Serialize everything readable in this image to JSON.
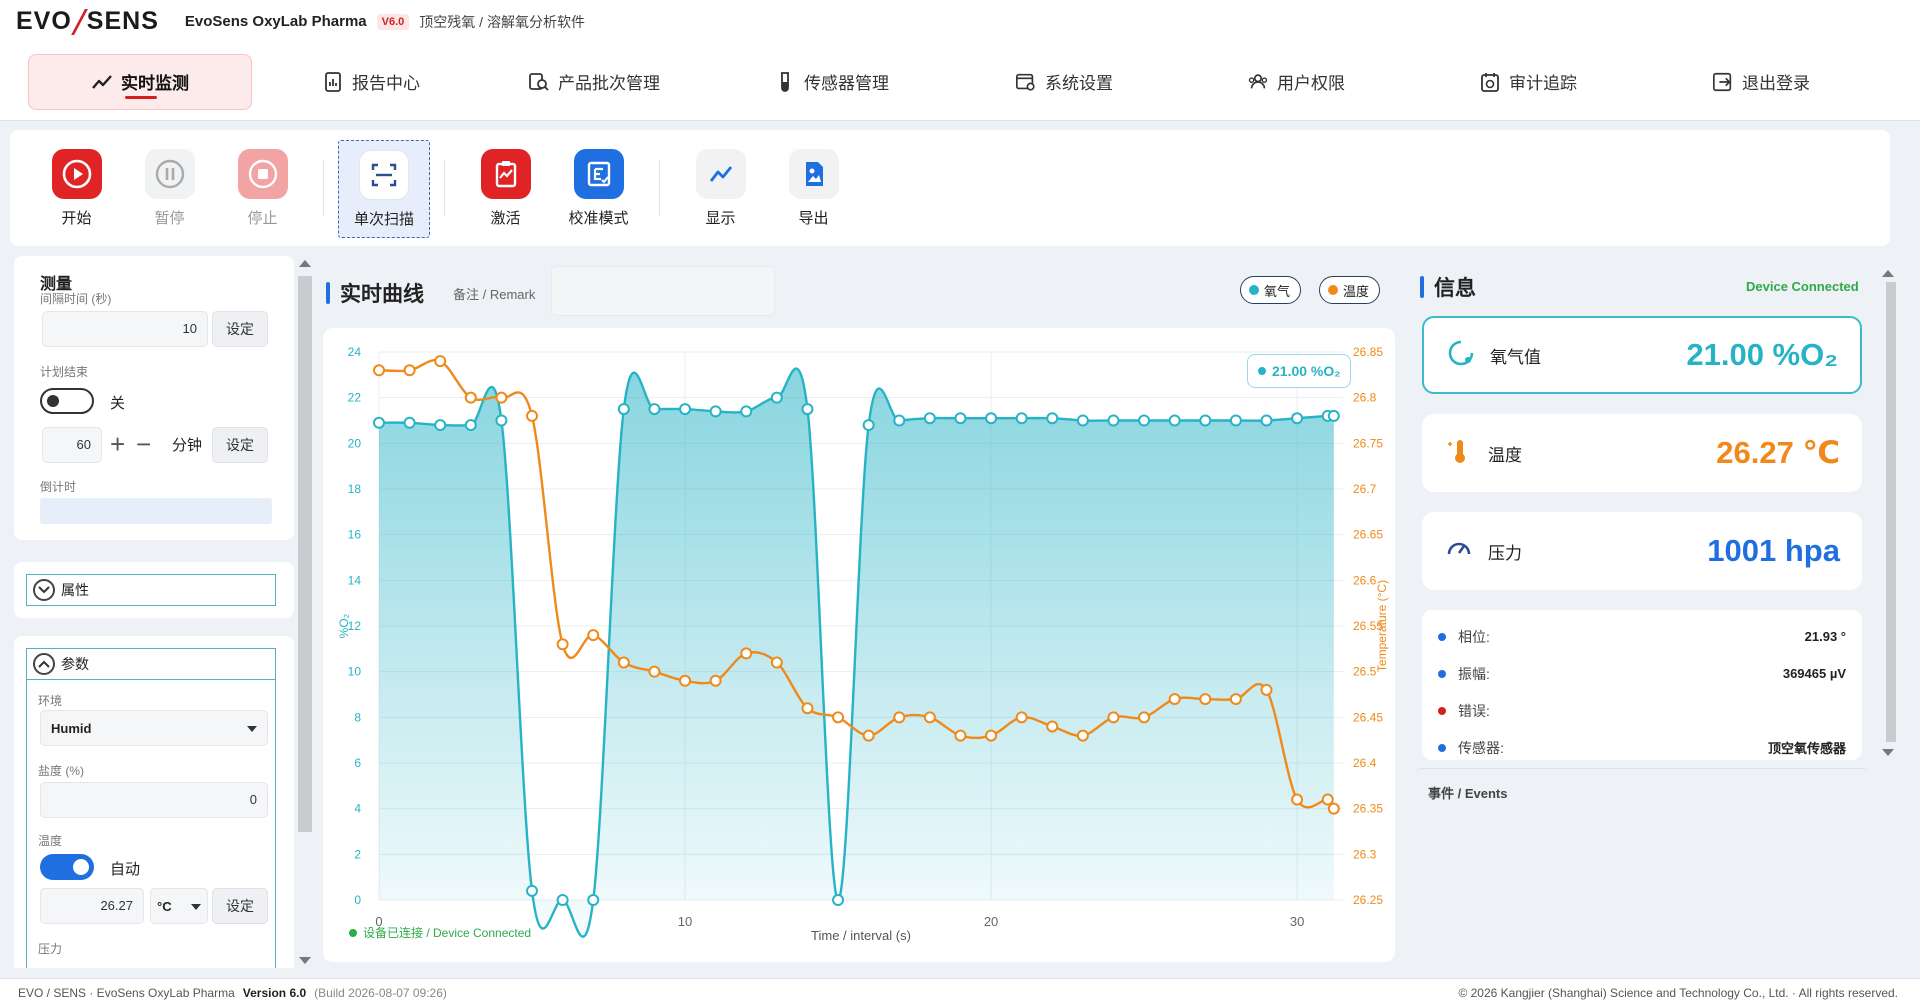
{
  "header": {
    "logo_left": "EVO",
    "logo_right": "SENS",
    "app_name": "EvoSens OxyLab Pharma",
    "version_badge": "V6.0",
    "subtitle": "顶空残氧 / 溶解氧分析软件"
  },
  "nav": [
    {
      "label": "实时监测",
      "icon": "trend-icon",
      "active": true
    },
    {
      "label": "报告中心",
      "icon": "report-icon"
    },
    {
      "label": "产品批次管理",
      "icon": "batch-search-icon"
    },
    {
      "label": "传感器管理",
      "icon": "test-tube-icon"
    },
    {
      "label": "系统设置",
      "icon": "settings-window-icon"
    },
    {
      "label": "用户权限",
      "icon": "users-icon"
    },
    {
      "label": "审计追踪",
      "icon": "audit-icon"
    },
    {
      "label": "退出登录",
      "icon": "logout-icon"
    }
  ],
  "toolbar": {
    "start": "开始",
    "pause": "暂停",
    "stop": "停止",
    "single_scan": "单次扫描",
    "activate": "激活",
    "calibrate": "校准模式",
    "display": "显示",
    "export": "导出"
  },
  "measure": {
    "title": "测量",
    "interval_label": "间隔时间 (秒)",
    "interval_value": "10",
    "set": "设定",
    "plan_end_label": "计划结束",
    "plan_toggle_state": "关",
    "plan_minutes": "60",
    "minutes_unit": "分钟",
    "countdown_label": "倒计时"
  },
  "attributes": {
    "title": "属性"
  },
  "params": {
    "title": "参数",
    "env_label": "环境",
    "env_value": "Humid",
    "salinity_label": "盐度 (%)",
    "salinity_value": "0",
    "temp_label": "温度",
    "temp_toggle_state": "自动",
    "temp_value": "26.27",
    "temp_unit": "°C",
    "pressure_label": "压力"
  },
  "chart_panel": {
    "title": "实时曲线",
    "remark_label": "备注 / Remark",
    "remark_value": "",
    "legend_oxygen": "氧气",
    "legend_temp": "温度",
    "current_badge": "21.00 %O₂",
    "status": "设备已连接 / Device Connected"
  },
  "chart_data": {
    "type": "line",
    "xlabel": "Time / interval (s)",
    "ylabel_left": "%O₂",
    "ylabel_right": "Temperature (°C)",
    "xlim": [
      0,
      31.5
    ],
    "ylim_left": [
      0,
      24
    ],
    "ylim_right": [
      26.25,
      26.85
    ],
    "x_ticks": [
      "0",
      "10",
      "20",
      "30"
    ],
    "y_ticks_left": [
      "0",
      "2",
      "4",
      "6",
      "8",
      "10",
      "12",
      "14",
      "16",
      "18",
      "20",
      "22",
      "24"
    ],
    "y_ticks_right": [
      "26.25",
      "26.3",
      "26.35",
      "26.4",
      "26.45",
      "26.5",
      "26.55",
      "26.6",
      "26.65",
      "26.7",
      "26.75",
      "26.8",
      "26.85"
    ],
    "grid": true,
    "series": [
      {
        "name": "氧气",
        "color": "#27b3c6",
        "axis": "left",
        "x": [
          0,
          1,
          2,
          3,
          4,
          5,
          6,
          7,
          8,
          9,
          10,
          11,
          12,
          13,
          14,
          15,
          16,
          17,
          18,
          19,
          20,
          21,
          22,
          23,
          24,
          25,
          26,
          27,
          28,
          29,
          30,
          31,
          31.2
        ],
        "values": [
          20.9,
          20.9,
          20.8,
          20.8,
          21.0,
          0.4,
          0.0,
          0.0,
          21.5,
          21.5,
          21.5,
          21.4,
          21.4,
          22.0,
          21.5,
          0.0,
          20.8,
          21.0,
          21.1,
          21.1,
          21.1,
          21.1,
          21.1,
          21.0,
          21.0,
          21.0,
          21.0,
          21.0,
          21.0,
          21.0,
          21.1,
          21.2,
          21.2
        ]
      },
      {
        "name": "温度",
        "color": "#ef8a1a",
        "axis": "right",
        "x": [
          0,
          1,
          2,
          3,
          4,
          5,
          6,
          7,
          8,
          9,
          10,
          11,
          12,
          13,
          14,
          15,
          16,
          17,
          18,
          19,
          20,
          21,
          22,
          23,
          24,
          25,
          26,
          27,
          28,
          29,
          30,
          31,
          31.2
        ],
        "values": [
          26.83,
          26.83,
          26.84,
          26.8,
          26.8,
          26.78,
          26.53,
          26.54,
          26.51,
          26.5,
          26.49,
          26.49,
          26.52,
          26.51,
          26.46,
          26.45,
          26.43,
          26.45,
          26.45,
          26.43,
          26.43,
          26.45,
          26.44,
          26.43,
          26.45,
          26.45,
          26.47,
          26.47,
          26.47,
          26.48,
          26.36,
          26.36,
          26.35
        ]
      }
    ]
  },
  "info": {
    "title": "信息",
    "status": "Device Connected",
    "oxygen_label": "氧气值",
    "oxygen_value": "21.00 %O₂",
    "temp_label": "温度",
    "temp_value": "26.27 ℃",
    "pressure_label": "压力",
    "pressure_value": "1001 hpa",
    "details": [
      {
        "label": "相位:",
        "value": "21.93 °",
        "color": "#1f6fe0"
      },
      {
        "label": "振幅:",
        "value": "369465 µV",
        "color": "#1f6fe0"
      },
      {
        "label": "错误:",
        "value": "",
        "color": "#d42020"
      },
      {
        "label": "传感器:",
        "value": "顶空氧传感器",
        "color": "#1f6fe0"
      }
    ],
    "events_title": "事件 / Events"
  },
  "footer": {
    "brand": "EVO / SENS · EvoSens OxyLab Pharma",
    "version": "Version 6.0",
    "build": "(Build 2026-08-07 09:26)",
    "copyright": "© 2026 Kangjier (Shanghai) Science and Technology Co., Ltd. · All rights reserved."
  },
  "colors": {
    "accent_red": "#d42020",
    "accent_blue": "#1f6fe0",
    "oxygen_teal": "#27b3c6",
    "temperature_orange": "#ef8a1a",
    "connected_green": "#2eaa4a"
  }
}
